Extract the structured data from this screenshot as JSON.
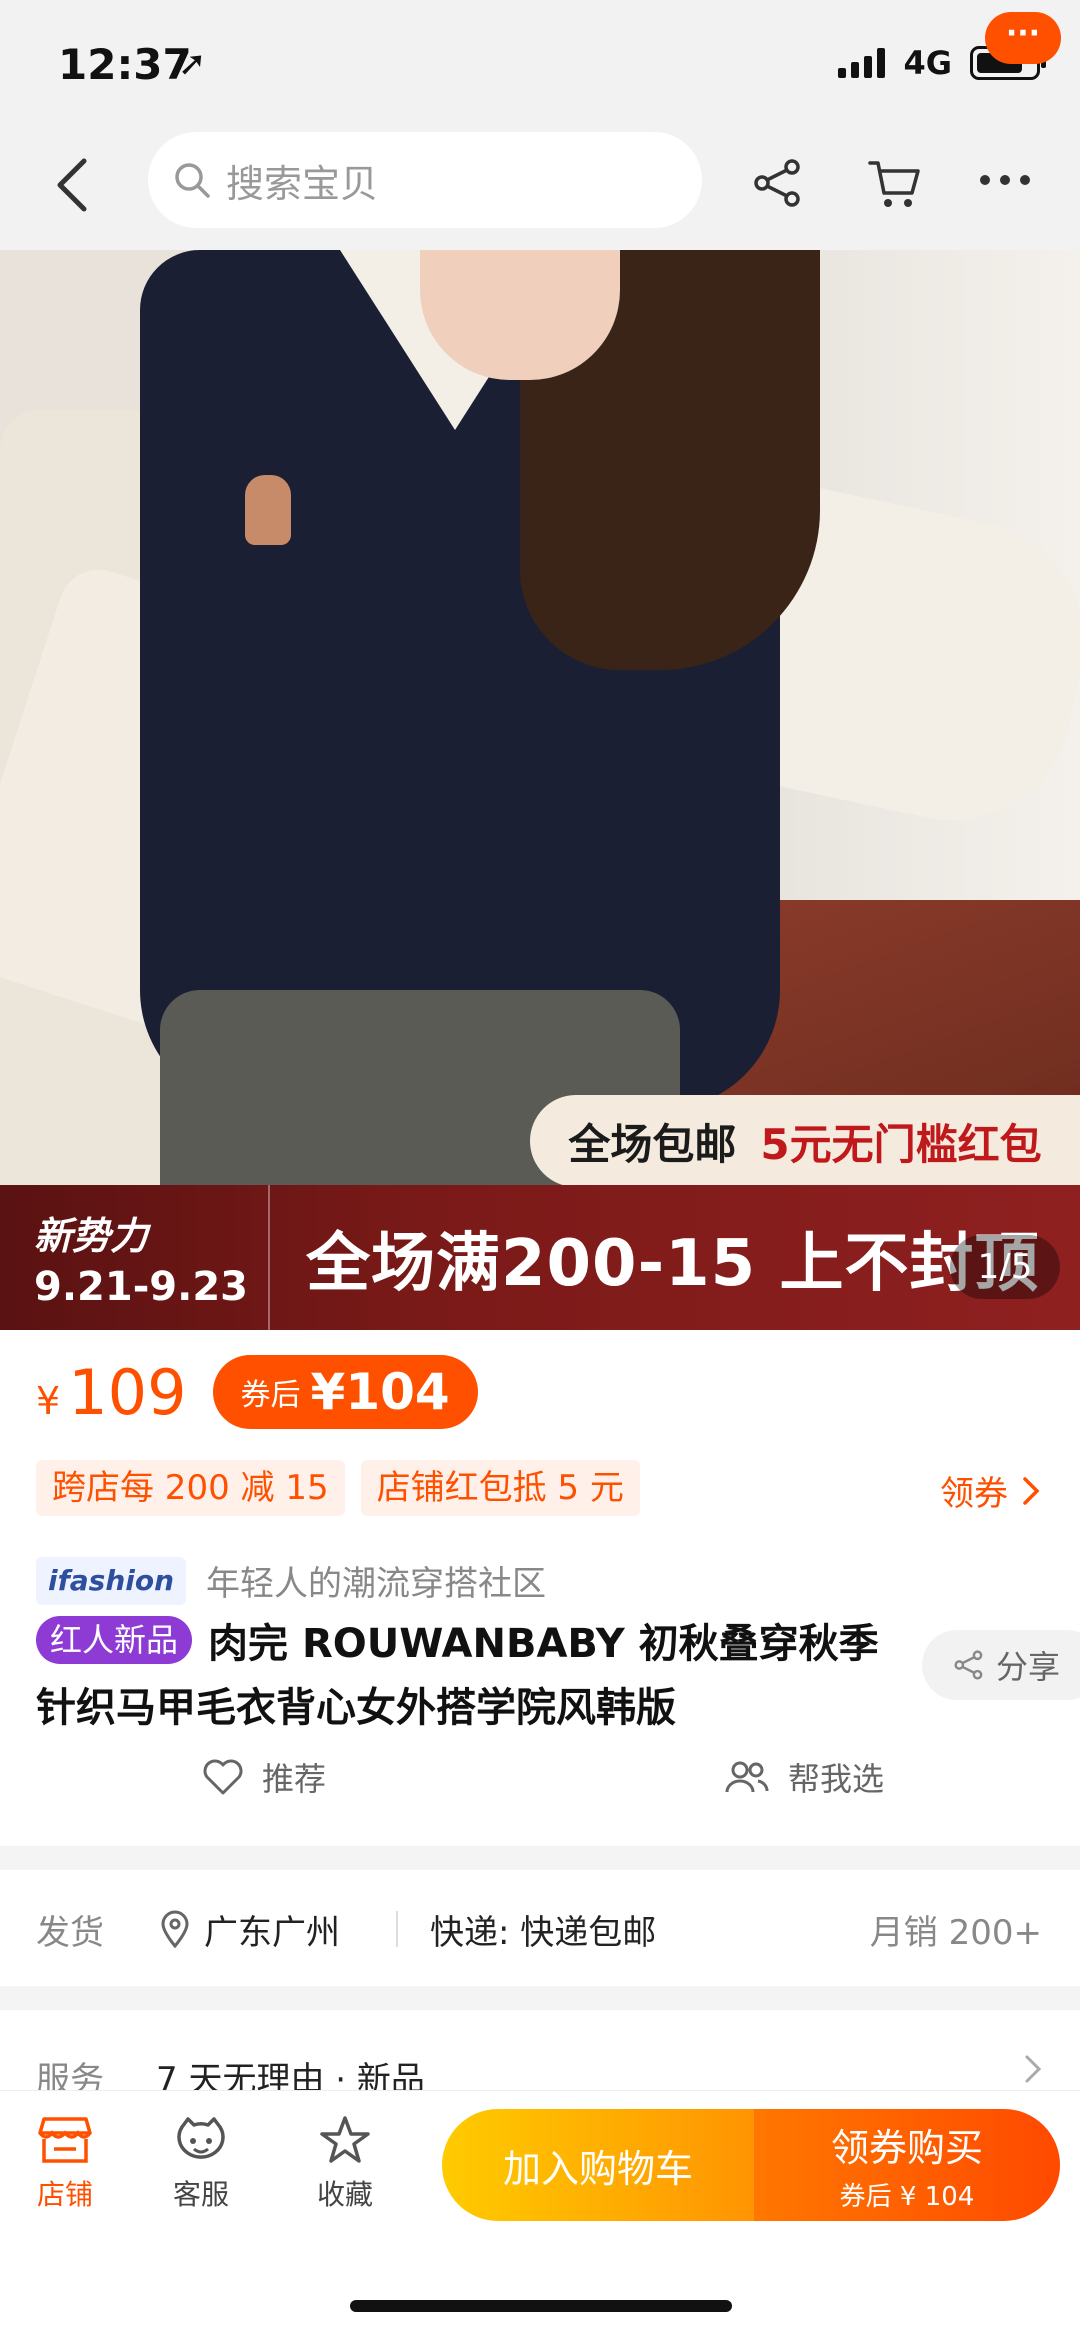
{
  "status": {
    "time": "12:37",
    "network": "4G"
  },
  "nav": {
    "search_placeholder": "搜索宝贝",
    "message_badge": "···"
  },
  "gallery": {
    "promo_free_shipping": "全场包邮",
    "promo_red_packet": "5元无门槛红包",
    "banner_brand": "新势力",
    "banner_dates": "9.21-9.23",
    "banner_main": "全场满200-15 上不封顶",
    "page_indicator": "1/5"
  },
  "price": {
    "currency": "¥",
    "current": "109",
    "coupon_label": "券后",
    "coupon_currency": "¥",
    "coupon_price": "104"
  },
  "promotions": {
    "tags": [
      "跨店每 200 减 15",
      "店铺红包抵 5 元"
    ],
    "get_coupon": "领券"
  },
  "ifashion": {
    "logo": "ifashion",
    "desc": "年轻人的潮流穿搭社区"
  },
  "product": {
    "badge": "红人新品",
    "title": "肉完 ROUWANBABY 初秋叠穿秋季针织马甲毛衣背心女外搭学院风韩版",
    "share": "分享",
    "recommend": "推荐",
    "help_choose": "帮我选"
  },
  "shipping": {
    "label": "发货",
    "location": "广东广州",
    "express": "快递: 快递包邮",
    "monthly_sales": "月销 200+"
  },
  "service": {
    "label": "服务",
    "value": "7 天无理由 · 新品"
  },
  "bottom": {
    "shop": "店铺",
    "customer_service": "客服",
    "favorite": "收藏",
    "add_to_cart": "加入购物车",
    "buy_label": "领券购买",
    "buy_sub": "券后 ¥ 104"
  },
  "colors": {
    "accent": "#ff5000",
    "cart_button": "#ffa500",
    "buy_button": "#ff5a00",
    "badge_purple": "#8e3bd6"
  }
}
